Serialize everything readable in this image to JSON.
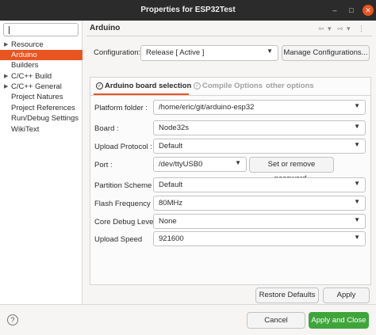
{
  "window": {
    "title": "Properties for ESP32Test"
  },
  "sidebar": {
    "filter_value": "",
    "items": [
      {
        "label": "Resource",
        "expandable": true
      },
      {
        "label": "Arduino",
        "expandable": false,
        "selected": true
      },
      {
        "label": "Builders",
        "expandable": false
      },
      {
        "label": "C/C++ Build",
        "expandable": true
      },
      {
        "label": "C/C++ General",
        "expandable": true
      },
      {
        "label": "Project Natures",
        "expandable": false
      },
      {
        "label": "Project References",
        "expandable": false
      },
      {
        "label": "Run/Debug Settings",
        "expandable": false
      },
      {
        "label": "WikiText",
        "expandable": false
      }
    ]
  },
  "page": {
    "title": "Arduino",
    "configuration_label": "Configuration:",
    "configuration_value": "Release  [ Active ]",
    "manage_button": "Manage Configurations..."
  },
  "tabs": [
    {
      "label": "Arduino board selection",
      "active": true
    },
    {
      "label": "Compile Options",
      "active": false
    },
    {
      "label": "other options",
      "active": false
    }
  ],
  "fields": {
    "platform_folder": {
      "label": "Platform folder :",
      "value": "/home/eric/git/arduino-esp32"
    },
    "board": {
      "label": "Board :",
      "value": "Node32s"
    },
    "upload_protocol": {
      "label": "Upload Protocol :",
      "value": "Default"
    },
    "port": {
      "label": "Port :",
      "value": "/dev/ttyUSB0",
      "password_button": "Set or remove password."
    },
    "partition_scheme": {
      "label": "Partition Scheme",
      "value": "Default"
    },
    "flash_frequency": {
      "label": "Flash Frequency",
      "value": "80MHz"
    },
    "core_debug_level": {
      "label": "Core Debug Level",
      "value": "None"
    },
    "upload_speed": {
      "label": "Upload Speed",
      "value": "921600"
    }
  },
  "buttons": {
    "restore_defaults": "Restore Defaults",
    "apply": "Apply",
    "cancel": "Cancel",
    "apply_and_close": "Apply and Close"
  },
  "colors": {
    "accent": "#e95420",
    "primary_button": "#3fa53b",
    "titlebar": "#2b2b2b"
  }
}
